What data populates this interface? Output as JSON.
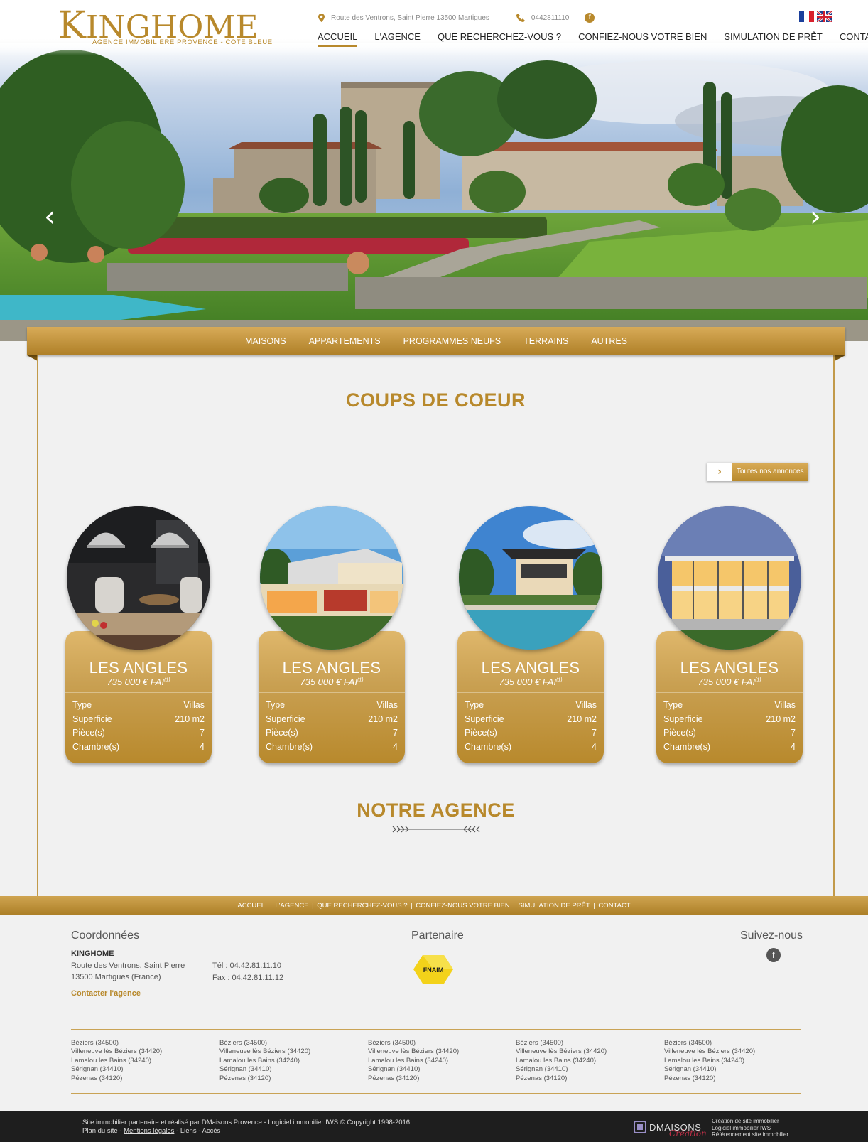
{
  "header": {
    "logo": {
      "main_first": "K",
      "main_rest": "INGHOME",
      "tagline": "AGENCE IMMOBILIERE PROVENCE - COTE BLEUE"
    },
    "address": "Route des Ventrons, Saint Pierre 13500 Martigues",
    "phone": "0442811110",
    "facebook_glyph": "f",
    "flags": [
      "fr-flag",
      "uk-flag"
    ]
  },
  "nav": {
    "items": [
      {
        "label": "ACCUEIL",
        "active": true
      },
      {
        "label": "L'AGENCE"
      },
      {
        "label": "QUE RECHERCHEZ-VOUS ?"
      },
      {
        "label": "CONFIEZ-NOUS VOTRE BIEN"
      },
      {
        "label": "SIMULATION DE PRÊT"
      },
      {
        "label": "CONTACT"
      }
    ]
  },
  "hero": {
    "prev_glyph": "‹",
    "next_glyph": "›"
  },
  "categories": [
    "MAISONS",
    "APPARTEMENTS",
    "PROGRAMMES NEUFS",
    "TERRAINS",
    "AUTRES"
  ],
  "coups": {
    "title": "COUPS DE COEUR",
    "all_button": {
      "icon": "›",
      "label": "Toutes nos annonces"
    },
    "cards": [
      {
        "city": "LES ANGLES",
        "price": "735 000 € FAI",
        "price_sup": "(1)",
        "rows": [
          [
            "Type",
            "Villas"
          ],
          [
            "Superficie",
            "210 m2"
          ],
          [
            "Pièce(s)",
            "7"
          ],
          [
            "Chambre(s)",
            "4"
          ]
        ]
      },
      {
        "city": "LES ANGLES",
        "price": "735 000 € FAI",
        "price_sup": "(1)",
        "rows": [
          [
            "Type",
            "Villas"
          ],
          [
            "Superficie",
            "210 m2"
          ],
          [
            "Pièce(s)",
            "7"
          ],
          [
            "Chambre(s)",
            "4"
          ]
        ]
      },
      {
        "city": "LES ANGLES",
        "price": "735 000 € FAI",
        "price_sup": "(1)",
        "rows": [
          [
            "Type",
            "Villas"
          ],
          [
            "Superficie",
            "210 m2"
          ],
          [
            "Pièce(s)",
            "7"
          ],
          [
            "Chambre(s)",
            "4"
          ]
        ]
      },
      {
        "city": "LES ANGLES",
        "price": "735 000 € FAI",
        "price_sup": "(1)",
        "rows": [
          [
            "Type",
            "Villas"
          ],
          [
            "Superficie",
            "210 m2"
          ],
          [
            "Pièce(s)",
            "7"
          ],
          [
            "Chambre(s)",
            "4"
          ]
        ]
      }
    ]
  },
  "agence": {
    "title": "NOTRE AGENCE"
  },
  "footer_nav": [
    "ACCUEIL",
    "L'AGENCE",
    "QUE RECHERCHEZ-VOUS ?",
    "CONFIEZ-NOUS VOTRE BIEN",
    "SIMULATION DE PRÊT",
    "CONTACT"
  ],
  "footer": {
    "coord_title": "Coordonnées",
    "agency_name": "KINGHOME",
    "address_line1": "Route des Ventrons, Saint Pierre",
    "address_line2": "13500 Martigues (France)",
    "tel": "Tél : 04.42.81.11.10",
    "fax": "Fax : 04.42.81.11.12",
    "contact_link": "Contacter l'agence",
    "partner_title": "Partenaire",
    "partner_logo_text": "FNAIM",
    "follow_title": "Suivez-nous",
    "facebook_glyph": "f",
    "city_columns": [
      [
        "Béziers (34500)",
        "Villeneuve lès Béziers (34420)",
        "Lamalou les Bains (34240)",
        "Sérignan (34410)",
        "Pézenas (34120)"
      ],
      [
        "Béziers (34500)",
        "Villeneuve lès Béziers (34420)",
        "Lamalou les Bains (34240)",
        "Sérignan (34410)",
        "Pézenas (34120)"
      ],
      [
        "Béziers (34500)",
        "Villeneuve lès Béziers (34420)",
        "Lamalou les Bains (34240)",
        "Sérignan (34410)",
        "Pézenas (34120)"
      ],
      [
        "Béziers (34500)",
        "Villeneuve lès Béziers (34420)",
        "Lamalou les Bains (34240)",
        "Sérignan (34410)",
        "Pézenas (34120)"
      ],
      [
        "Béziers (34500)",
        "Villeneuve lès Béziers (34420)",
        "Lamalou les Bains (34240)",
        "Sérignan (34410)",
        "Pézenas (34120)"
      ]
    ]
  },
  "bottom": {
    "credit_line1": "Site immobilier partenaire et réalisé par DMaisons Provence - Logiciel immobilier IWS © Copyright 1998-2016",
    "plan": "Plan du site",
    "mentions": "Mentions légales",
    "liens": "Liens",
    "acces": "Accès",
    "dm_name": "DMAISONS",
    "dm_creation": "Création",
    "dm_lines": [
      "Création de site immobilier",
      "Logiciel immobilier IWS",
      "Référencement site immobilier"
    ]
  },
  "colors": {
    "gold": "#b8892c",
    "gold_light": "#d9b063",
    "footer_dark": "#1e1e1e"
  }
}
